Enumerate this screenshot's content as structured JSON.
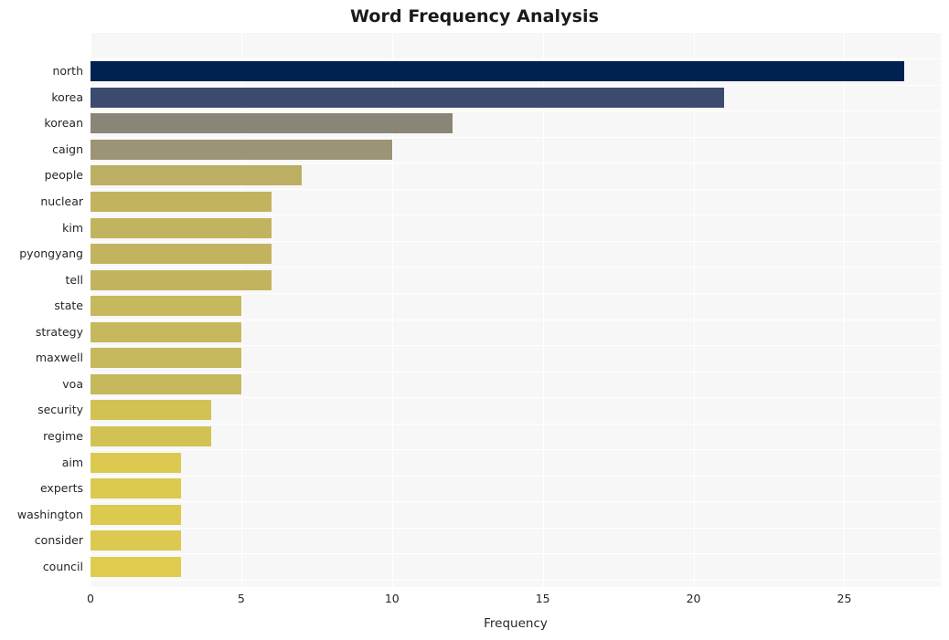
{
  "chart_data": {
    "type": "bar",
    "orientation": "horizontal",
    "title": "Word Frequency Analysis",
    "xlabel": "Frequency",
    "ylabel": "",
    "categories": [
      "north",
      "korea",
      "korean",
      "caign",
      "people",
      "nuclear",
      "kim",
      "pyongyang",
      "tell",
      "state",
      "strategy",
      "maxwell",
      "voa",
      "security",
      "regime",
      "aim",
      "experts",
      "washington",
      "consider",
      "council"
    ],
    "values": [
      27,
      21,
      12,
      10,
      7,
      6,
      6,
      6,
      6,
      5,
      5,
      5,
      5,
      4,
      4,
      3,
      3,
      3,
      3,
      3
    ],
    "bar_colors": [
      "#002250",
      "#3d4a70",
      "#8a8677",
      "#9b9476",
      "#bcae63",
      "#c2b45f",
      "#c2b45f",
      "#c2b45f",
      "#c2b45f",
      "#c6b85c",
      "#c6b85c",
      "#c6b85c",
      "#c6b85c",
      "#d2c253",
      "#d2c253",
      "#dcc94f",
      "#dcc94f",
      "#dcc94f",
      "#dcc94f",
      "#dfcc4e"
    ],
    "xlim": [
      0,
      28.2
    ],
    "xticks": [
      0,
      5,
      10,
      15,
      20,
      25
    ],
    "xtick_labels": [
      "0",
      "5",
      "10",
      "15",
      "20",
      "25"
    ],
    "grid": true,
    "grid_color": "#ffffff",
    "plot_background": "#f7f7f7",
    "figure_background": "#ffffff",
    "legend": null,
    "legend_position": "none"
  }
}
